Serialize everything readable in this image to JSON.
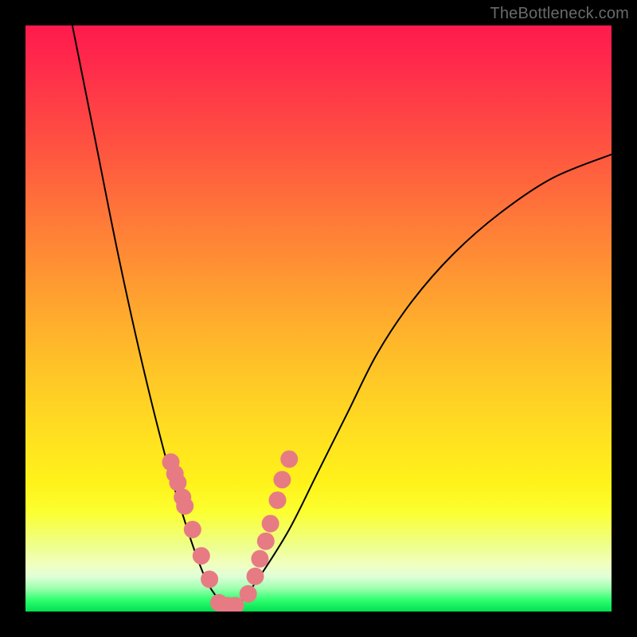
{
  "watermark": {
    "text": "TheBottleneck.com"
  },
  "chart_data": {
    "type": "line",
    "title": "",
    "xlabel": "",
    "ylabel": "",
    "xlim": [
      0,
      1
    ],
    "ylim": [
      0,
      1
    ],
    "series": [
      {
        "name": "bottleneck-curve",
        "x": [
          0.08,
          0.12,
          0.16,
          0.2,
          0.24,
          0.27,
          0.29,
          0.31,
          0.33,
          0.35,
          0.37,
          0.4,
          0.45,
          0.5,
          0.55,
          0.6,
          0.66,
          0.73,
          0.81,
          0.9,
          1.0
        ],
        "y": [
          1.0,
          0.8,
          0.6,
          0.42,
          0.26,
          0.16,
          0.1,
          0.05,
          0.02,
          0.0,
          0.02,
          0.06,
          0.14,
          0.24,
          0.34,
          0.44,
          0.53,
          0.61,
          0.68,
          0.74,
          0.78
        ]
      }
    ],
    "markers": {
      "name": "highlight-dots",
      "color": "#e77b84",
      "x": [
        0.248,
        0.255,
        0.26,
        0.268,
        0.272,
        0.285,
        0.3,
        0.314,
        0.33,
        0.345,
        0.358,
        0.38,
        0.392,
        0.4,
        0.41,
        0.418,
        0.43,
        0.438,
        0.45
      ],
      "y": [
        0.255,
        0.235,
        0.22,
        0.195,
        0.18,
        0.14,
        0.095,
        0.055,
        0.015,
        0.01,
        0.01,
        0.03,
        0.06,
        0.09,
        0.12,
        0.15,
        0.19,
        0.225,
        0.26
      ]
    },
    "gradient_stops": [
      {
        "pos": 0.0,
        "color": "#ff1a4d"
      },
      {
        "pos": 0.5,
        "color": "#ffb028"
      },
      {
        "pos": 0.8,
        "color": "#fff21a"
      },
      {
        "pos": 1.0,
        "color": "#00e050"
      }
    ]
  }
}
